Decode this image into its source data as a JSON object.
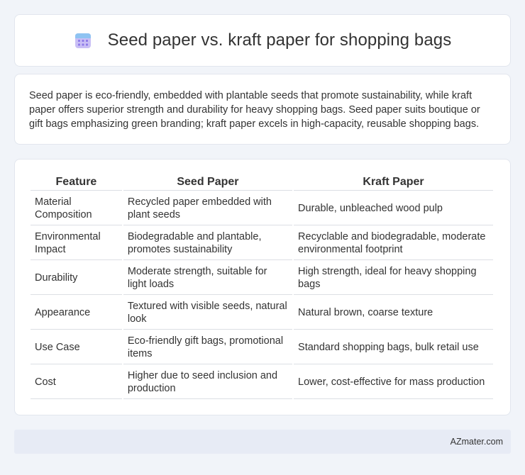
{
  "header": {
    "title": "Seed paper vs. kraft paper for shopping bags",
    "icon": "calendar-icon",
    "icon_color": "#8e7ae8"
  },
  "summary": {
    "text": "Seed paper is eco-friendly, embedded with plantable seeds that promote sustainability, while kraft paper offers superior strength and durability for heavy shopping bags. Seed paper suits boutique or gift bags emphasizing green branding; kraft paper excels in high-capacity, reusable shopping bags."
  },
  "table": {
    "headers": [
      "Feature",
      "Seed Paper",
      "Kraft Paper"
    ],
    "rows": [
      [
        "Material Composition",
        "Recycled paper embedded with plant seeds",
        "Durable, unbleached wood pulp"
      ],
      [
        "Environmental Impact",
        "Biodegradable and plantable, promotes sustainability",
        "Recyclable and biodegradable, moderate environmental footprint"
      ],
      [
        "Durability",
        "Moderate strength, suitable for light loads",
        "High strength, ideal for heavy shopping bags"
      ],
      [
        "Appearance",
        "Textured with visible seeds, natural look",
        "Natural brown, coarse texture"
      ],
      [
        "Use Case",
        "Eco-friendly gift bags, promotional items",
        "Standard shopping bags, bulk retail use"
      ],
      [
        "Cost",
        "Higher due to seed inclusion and production",
        "Lower, cost-effective for mass production"
      ]
    ]
  },
  "footer": {
    "brand": "AZmater.com"
  }
}
